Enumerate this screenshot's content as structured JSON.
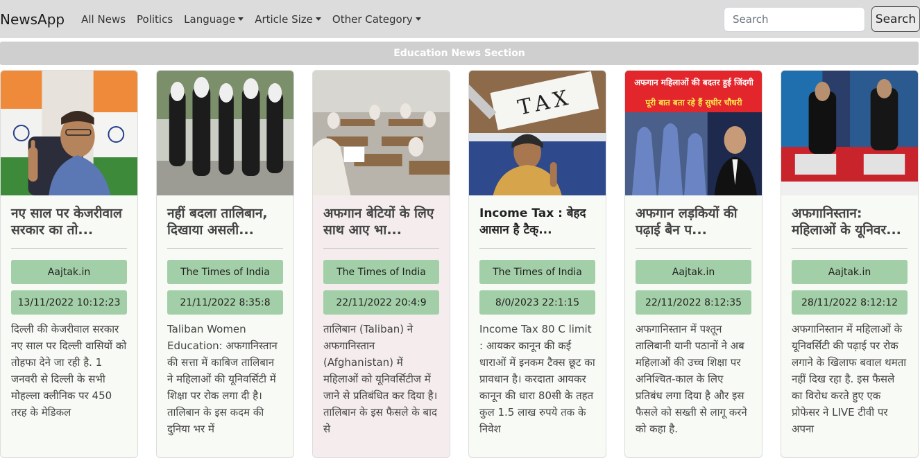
{
  "navbar": {
    "brand": "NewsApp",
    "links": [
      "All News",
      "Politics"
    ],
    "dropdowns": [
      "Language",
      "Article Size",
      "Other Category"
    ],
    "search_placeholder": "Search",
    "search_button": "Search"
  },
  "section": {
    "title": "Education News Section"
  },
  "cards": [
    {
      "title": "नए साल पर केजरीवाल सरकार का तो...",
      "source": "Aajtak.in",
      "date": "13/11/2022 10:12:23",
      "text": "दिल्ली की केजरीवाल सरकार नए साल पर दिल्ली वासियों को तोहफा देने जा रही है. 1 जनवरी से दिल्ली के सभी मोहल्ला क्लीनिक पर 450 तरह के मेडिकल"
    },
    {
      "title": "नहीं बदला तालिबान, दिखाया असली...",
      "source": "The Times of India",
      "date": "21/11/2022 8:35:8",
      "text": "Taliban Women Education: अफगानिस्तान की सत्ता में काबिज तालिबान ने महिलाओं की यूनिवर्सिटी में शिक्षा पर रोक लगा दी है। तालिबान के इस कदम की दुनिया भर में"
    },
    {
      "title": "अफगान बेटियों के लिए साथ आए भा...",
      "source": "The Times of India",
      "date": "22/11/2022 20:4:9",
      "text": "तालिबान (Taliban) ने अफगानिस्तान (Afghanistan) में महिलाओं को यूनिवर्सिटीज में जाने से प्रतिबंधित कर दिया है। तालिबान के इस फैसले के बाद से"
    },
    {
      "title": "Income Tax : बेहद आसान है टैक्...",
      "source": "The Times of India",
      "date": "8/0/2023 22:1:15",
      "text": "Income Tax 80 C limit : आयकर कानून की कई धाराओं में इनकम टैक्स छूट का प्रावधान है। करदाता आयकर कानून की धारा 80सी के तहत कुल 1.5 लाख रुपये तक के निवेश"
    },
    {
      "title": "अफगान लड़कियों की पढ़ाई बैन प...",
      "source": "Aajtak.in",
      "date": "22/11/2022 8:12:35",
      "text": "अफगानिस्तान में पश्तून तालिबानी यानी पठानों ने अब महिलाओं की उच्च शिक्षा पर अनिश्चित-काल के लिए प्रतिबंध लगा दिया है और इस फैसले को सख्ती से लागू करने को कहा है.",
      "thumb_caption_1": "अफगान महिलाओं की बदतर हुई जिंदगी",
      "thumb_caption_2": "पूरी बात बता रहे हैं सुधीर चौधरी"
    },
    {
      "title": "अफगानिस्तान: महिलाओं के यूनिवर...",
      "source": "Aajtak.in",
      "date": "28/11/2022 8:12:12",
      "text": "अफगानिस्तान में महिलाओं के यूनिवर्सिटी की पढ़ाई पर रोक लगाने के खिलाफ बवाल थमता नहीं दिख रहा है. इस फैसले का विरोध करते हुए एक प्रोफेसर ने LIVE टीवी पर अपना"
    }
  ],
  "thumb_tax_word": "TAX",
  "colors": {
    "navbar_bg": "#dcdcdc",
    "section_bar_bg": "#cfcfcf",
    "badge_bg": "#a3cfa8",
    "card_bg": "#f8faf6",
    "card_bg_highlight": "#f5eded"
  }
}
